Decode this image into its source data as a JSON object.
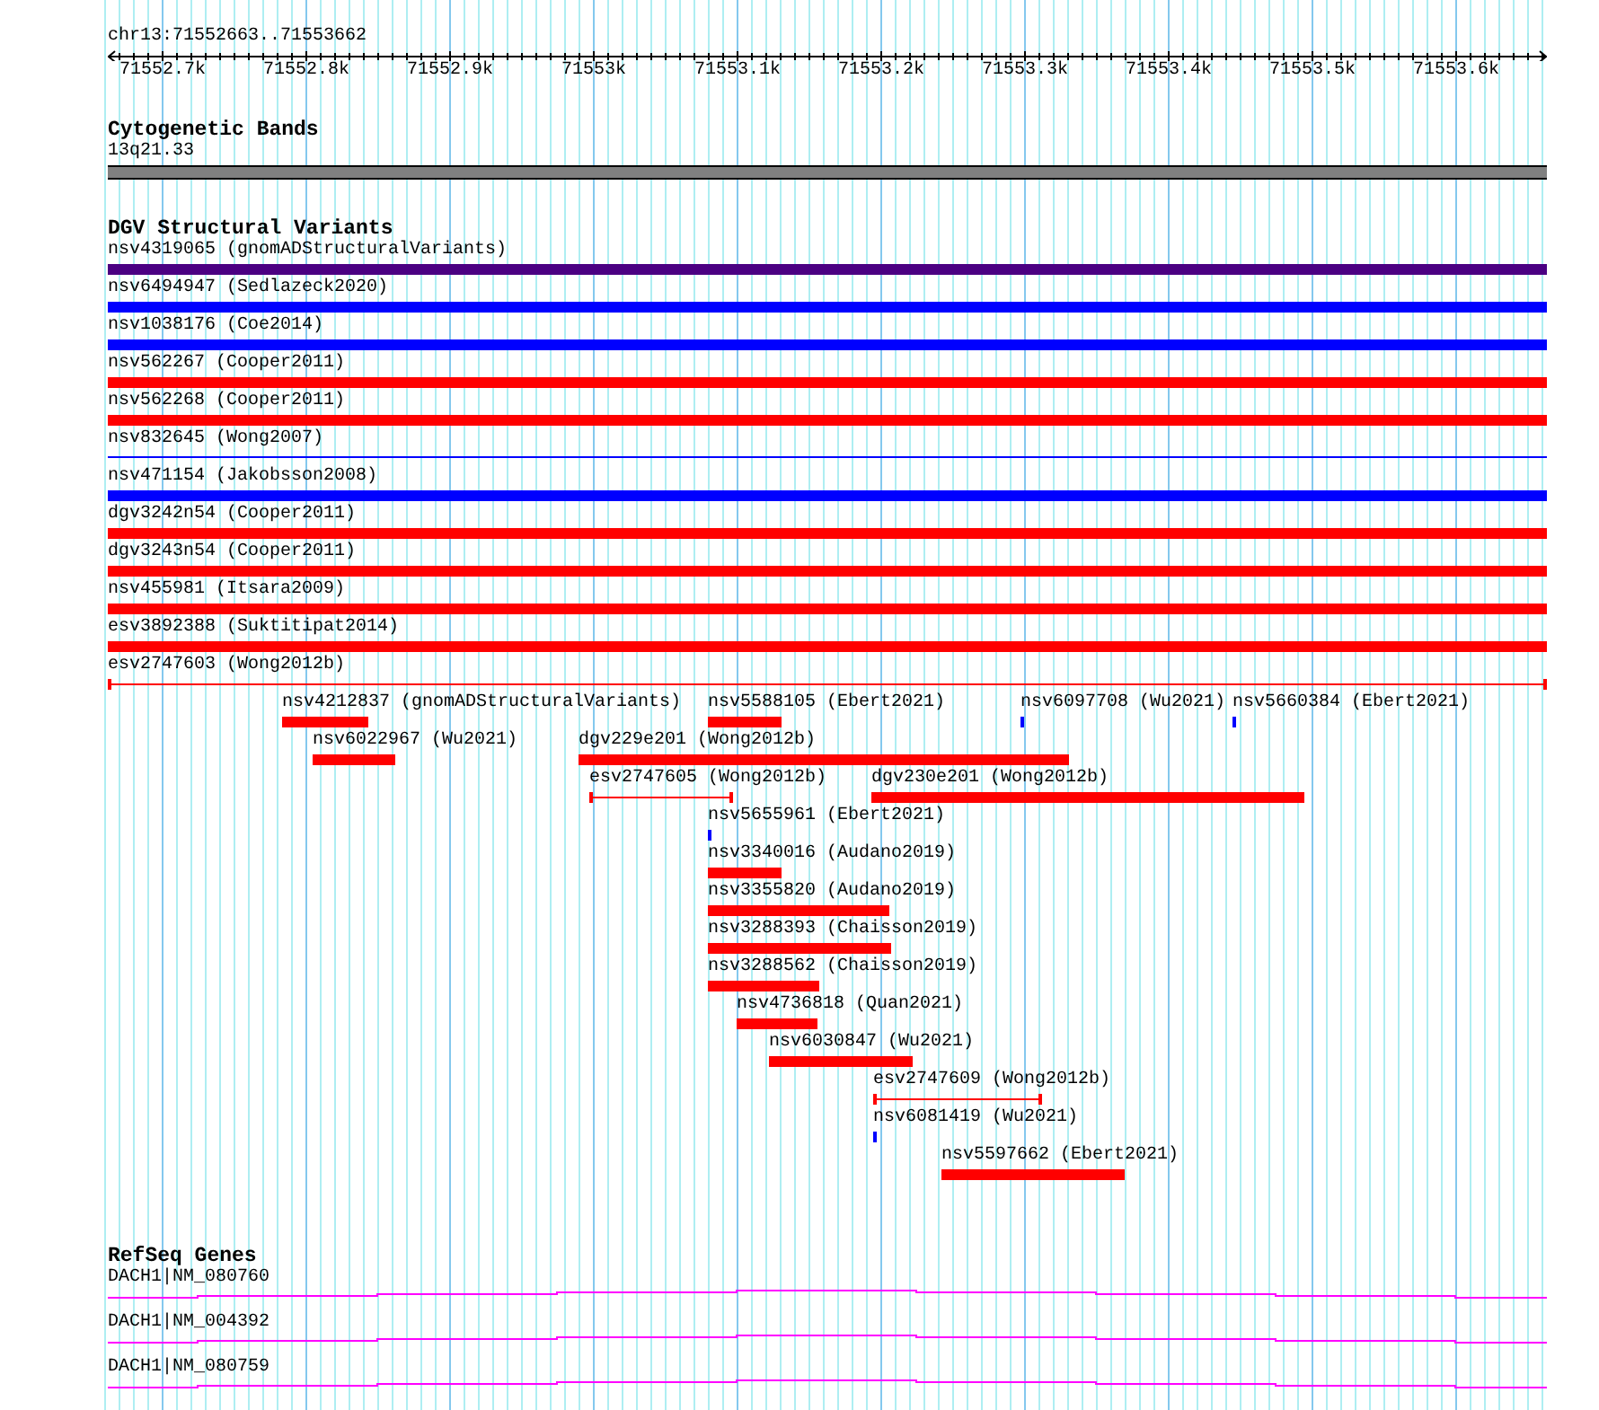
{
  "ruler": {
    "location": "chr13:71552663..71553662",
    "ticks": [
      "71552.7k",
      "71552.8k",
      "71552.9k",
      "71553k",
      "71553.1k",
      "71553.2k",
      "71553.3k",
      "71553.4k",
      "71553.5k",
      "71553.6k"
    ]
  },
  "cytogenetic_bands": {
    "title": "Cytogenetic Bands",
    "bands": [
      {
        "label": "13q21.33"
      }
    ]
  },
  "dgv_structural_variants": {
    "title": "DGV Structural Variants",
    "rows": [
      {
        "features": [
          {
            "label": "nsv4319065 (gnomADStructuralVariants)",
            "color": "#4b0082",
            "kind": "bar"
          }
        ]
      },
      {
        "features": [
          {
            "label": "nsv6494947 (Sedlazeck2020)",
            "color": "#0000ff",
            "kind": "bar"
          }
        ]
      },
      {
        "features": [
          {
            "label": "nsv1038176 (Coe2014)",
            "color": "#0000ff",
            "kind": "bar"
          }
        ]
      },
      {
        "features": [
          {
            "label": "nsv562267 (Cooper2011)",
            "color": "#ff0000",
            "kind": "bar"
          }
        ]
      },
      {
        "features": [
          {
            "label": "nsv562268 (Cooper2011)",
            "color": "#ff0000",
            "kind": "bar"
          }
        ]
      },
      {
        "features": [
          {
            "label": "nsv832645 (Wong2007)",
            "color": "#0000ff",
            "kind": "line"
          }
        ]
      },
      {
        "features": [
          {
            "label": "nsv471154 (Jakobsson2008)",
            "color": "#0000ff",
            "kind": "bar"
          }
        ]
      },
      {
        "features": [
          {
            "label": "dgv3242n54 (Cooper2011)",
            "color": "#ff0000",
            "kind": "bar"
          }
        ]
      },
      {
        "features": [
          {
            "label": "dgv3243n54 (Cooper2011)",
            "color": "#ff0000",
            "kind": "bar"
          }
        ]
      },
      {
        "features": [
          {
            "label": "nsv455981 (Itsara2009)",
            "color": "#ff0000",
            "kind": "bar"
          }
        ]
      },
      {
        "features": [
          {
            "label": "esv3892388 (Suktitipat2014)",
            "color": "#ff0000",
            "kind": "bar"
          }
        ]
      },
      {
        "features": [
          {
            "label": "esv2747603 (Wong2012b)",
            "color": "#ff0000",
            "kind": "span"
          }
        ]
      },
      {
        "features": [
          {
            "label": "nsv4212837 (gnomADStructuralVariants)",
            "color": "#ff0000",
            "kind": "bar"
          },
          {
            "label": "nsv5588105 (Ebert2021)",
            "color": "#ff0000",
            "kind": "bar"
          },
          {
            "label": "nsv6097708 (Wu2021)",
            "color": "#0000ff",
            "kind": "bar"
          },
          {
            "label": "nsv5660384 (Ebert2021)",
            "color": "#0000ff",
            "kind": "bar"
          }
        ]
      },
      {
        "features": [
          {
            "label": "nsv6022967 (Wu2021)",
            "color": "#ff0000",
            "kind": "bar"
          },
          {
            "label": "dgv229e201 (Wong2012b)",
            "color": "#ff0000",
            "kind": "bar"
          }
        ]
      },
      {
        "features": [
          {
            "label": "esv2747605 (Wong2012b)",
            "color": "#ff0000",
            "kind": "span"
          },
          {
            "label": "dgv230e201 (Wong2012b)",
            "color": "#ff0000",
            "kind": "bar"
          }
        ]
      },
      {
        "features": [
          {
            "label": "nsv5655961 (Ebert2021)",
            "color": "#0000ff",
            "kind": "bar"
          }
        ]
      },
      {
        "features": [
          {
            "label": "nsv3340016 (Audano2019)",
            "color": "#ff0000",
            "kind": "bar"
          }
        ]
      },
      {
        "features": [
          {
            "label": "nsv3355820 (Audano2019)",
            "color": "#ff0000",
            "kind": "bar"
          }
        ]
      },
      {
        "features": [
          {
            "label": "nsv3288393 (Chaisson2019)",
            "color": "#ff0000",
            "kind": "bar"
          }
        ]
      },
      {
        "features": [
          {
            "label": "nsv3288562 (Chaisson2019)",
            "color": "#ff0000",
            "kind": "bar"
          }
        ]
      },
      {
        "features": [
          {
            "label": "nsv4736818 (Quan2021)",
            "color": "#ff0000",
            "kind": "bar"
          }
        ]
      },
      {
        "features": [
          {
            "label": "nsv6030847 (Wu2021)",
            "color": "#ff0000",
            "kind": "bar"
          }
        ]
      },
      {
        "features": [
          {
            "label": "esv2747609 (Wong2012b)",
            "color": "#ff0000",
            "kind": "span"
          }
        ]
      },
      {
        "features": [
          {
            "label": "nsv6081419 (Wu2021)",
            "color": "#0000ff",
            "kind": "bar"
          }
        ]
      },
      {
        "features": [
          {
            "label": "nsv5597662 (Ebert2021)",
            "color": "#ff0000",
            "kind": "bar"
          }
        ]
      }
    ]
  },
  "refseq_genes": {
    "title": "RefSeq Genes",
    "genes": [
      {
        "label": "DACH1|NM_080760"
      },
      {
        "label": "DACH1|NM_004392"
      },
      {
        "label": "DACH1|NM_080759"
      }
    ]
  }
}
